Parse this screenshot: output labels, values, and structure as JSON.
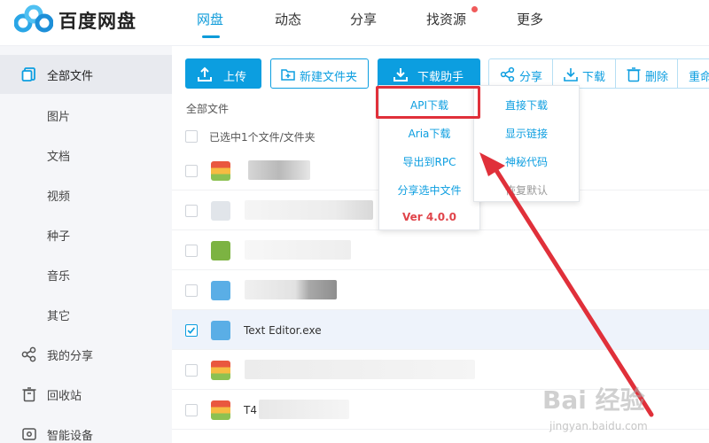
{
  "app": {
    "brand": "百度网盘"
  },
  "nav": [
    {
      "label": "网盘",
      "active": true
    },
    {
      "label": "动态"
    },
    {
      "label": "分享"
    },
    {
      "label": "找资源",
      "has_dot": true
    },
    {
      "label": "更多"
    }
  ],
  "sidebar": {
    "items": [
      {
        "label": "全部文件",
        "icon": "file-icon",
        "active": true
      },
      {
        "label": "图片"
      },
      {
        "label": "文档"
      },
      {
        "label": "视频"
      },
      {
        "label": "种子"
      },
      {
        "label": "音乐"
      },
      {
        "label": "其它"
      },
      {
        "label": "我的分享",
        "icon": "share-icon"
      },
      {
        "label": "回收站",
        "icon": "trash-icon"
      },
      {
        "label": "智能设备",
        "icon": "device-icon"
      }
    ]
  },
  "toolbar": {
    "upload": "上传",
    "new_folder": "新建文件夹",
    "download_helper": "下载助手",
    "share": "分享",
    "download": "下载",
    "delete": "删除",
    "rename": "重命"
  },
  "list": {
    "breadcrumb": "全部文件",
    "select_info": "已选中1个文件/文件夹",
    "rows": [
      {
        "icon": "archive-icon",
        "name": "",
        "checked": false
      },
      {
        "icon": "cloud-file-icon",
        "name": "",
        "checked": false
      },
      {
        "icon": "android-apk-icon",
        "name": "",
        "checked": false
      },
      {
        "icon": "exe-file-icon",
        "name": "",
        "checked": false
      },
      {
        "icon": "exe-file-icon",
        "name": "Text Editor.exe",
        "checked": true
      },
      {
        "icon": "archive-icon",
        "name": "",
        "checked": false
      },
      {
        "icon": "archive-icon",
        "name": "T4",
        "checked": false
      }
    ]
  },
  "menu_left": {
    "items": [
      "API下载",
      "Aria下载",
      "导出到RPC",
      "分享选中文件",
      "Ver 4.0.0"
    ]
  },
  "menu_right": {
    "items": [
      "直接下载",
      "显示链接",
      "神秘代码",
      "恢复默认"
    ]
  },
  "watermark": {
    "main": "Bai 经验",
    "sub": "jingyan.baidu.com"
  },
  "colors": {
    "accent": "#0c9ee0",
    "highlight": "#e0303a",
    "sidebar_bg": "#f5f6f9"
  }
}
